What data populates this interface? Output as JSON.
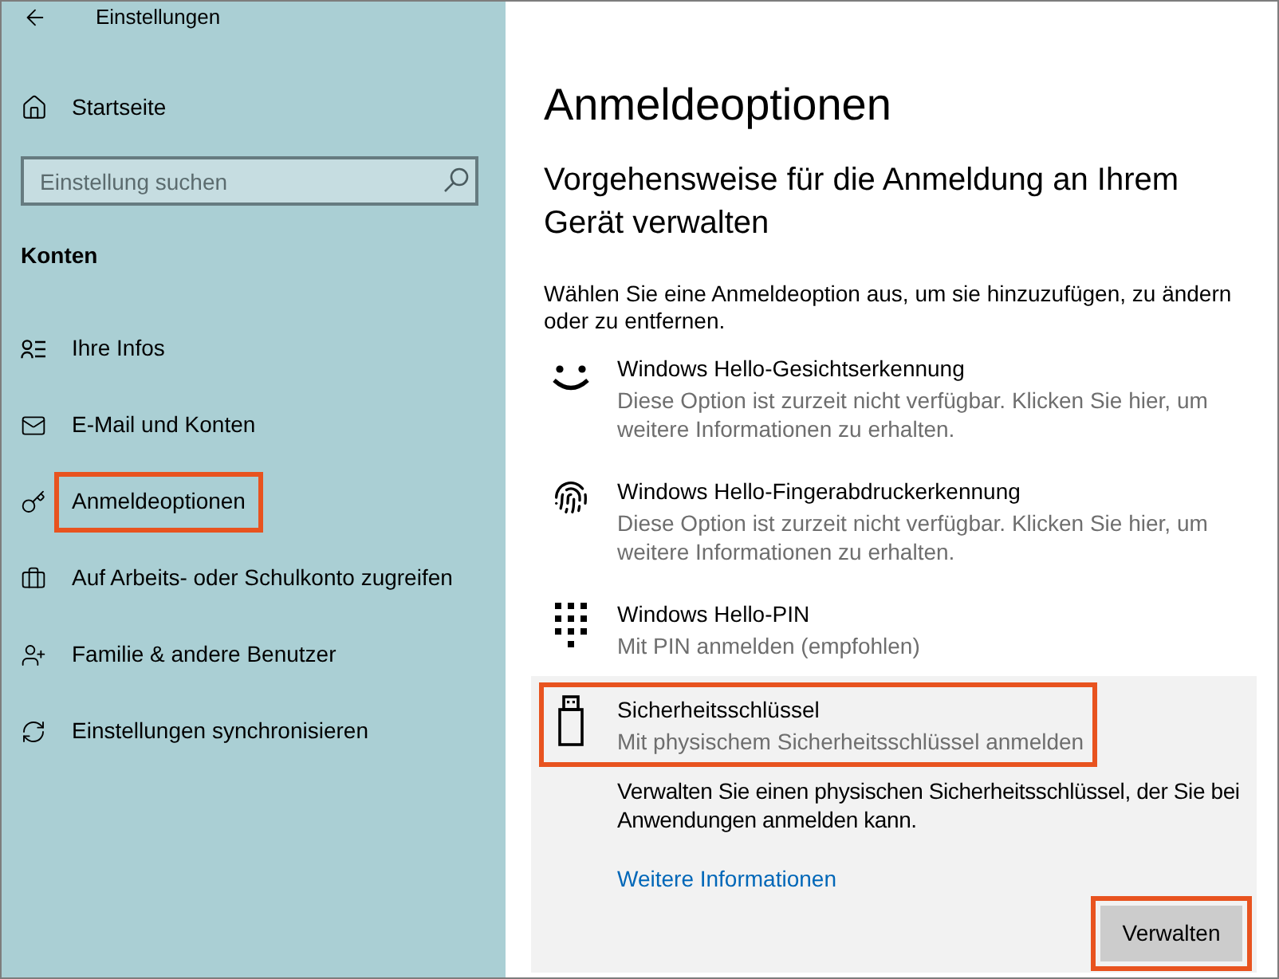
{
  "window": {
    "title": "Einstellungen"
  },
  "sidebar": {
    "home": "Startseite",
    "search": {
      "placeholder": "Einstellung suchen"
    },
    "section": "Konten",
    "items": [
      {
        "label": "Ihre Infos",
        "highlighted": false
      },
      {
        "label": "E-Mail und Konten",
        "highlighted": false
      },
      {
        "label": "Anmeldeoptionen",
        "highlighted": true
      },
      {
        "label": "Auf Arbeits- oder Schulkonto zugreifen",
        "highlighted": false
      },
      {
        "label": "Familie & andere Benutzer",
        "highlighted": false
      },
      {
        "label": "Einstellungen synchronisieren",
        "highlighted": false
      }
    ]
  },
  "page": {
    "title": "Anmeldeoptionen",
    "subtitle": "Vorgehensweise für die Anmeldung an Ihrem Gerät verwalten",
    "intro": "Wählen Sie eine Anmeldeoption aus, um sie hinzuzufügen, zu ändern oder zu entfernen.",
    "options": [
      {
        "title": "Windows Hello-Gesichtserkennung",
        "subtitle": "Diese Option ist zurzeit nicht verfügbar. Klicken Sie hier, um weitere Informationen zu erhalten.",
        "expanded": false,
        "highlighted": false
      },
      {
        "title": "Windows Hello-Fingerabdruckerkennung",
        "subtitle": "Diese Option ist zurzeit nicht verfügbar. Klicken Sie hier, um weitere Informationen zu erhalten.",
        "expanded": false,
        "highlighted": false
      },
      {
        "title": "Windows Hello-PIN",
        "subtitle": "Mit PIN anmelden (empfohlen)",
        "expanded": false,
        "highlighted": false
      },
      {
        "title": "Sicherheitsschlüssel",
        "subtitle": "Mit physischem Sicherheitsschlüssel anmelden",
        "expanded": true,
        "highlighted": true,
        "description": "Verwalten Sie einen physischen Sicherheitsschlüssel, der Sie bei Anwendungen anmelden kann.",
        "link": "Weitere Informationen",
        "button": {
          "label": "Verwalten",
          "highlighted": true
        }
      }
    ]
  }
}
